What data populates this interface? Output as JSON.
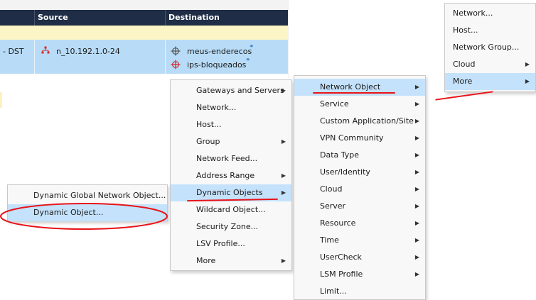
{
  "table": {
    "columns": [
      "Source",
      "Destination"
    ],
    "row": {
      "left_text": "- DST",
      "source": "n_10.192.1.0-24",
      "destinations": [
        "meus-enderecos",
        "ips-bloqueados"
      ]
    }
  },
  "menu_left": {
    "items": [
      "Dynamic Global Network Object...",
      "Dynamic Object..."
    ]
  },
  "menu_main": {
    "items": [
      {
        "label": "Gateways and Servers",
        "submenu": true
      },
      {
        "label": "Network...",
        "submenu": false
      },
      {
        "label": "Host...",
        "submenu": false
      },
      {
        "label": "Group",
        "submenu": true
      },
      {
        "label": "Network Feed...",
        "submenu": false
      },
      {
        "label": "Address Range",
        "submenu": true
      },
      {
        "label": "Dynamic Objects",
        "submenu": true
      },
      {
        "label": "Wildcard Object...",
        "submenu": false
      },
      {
        "label": "Security Zone...",
        "submenu": false
      },
      {
        "label": "LSV Profile...",
        "submenu": false
      },
      {
        "label": "More",
        "submenu": true
      }
    ]
  },
  "menu_categories": {
    "items": [
      {
        "label": "Network Object",
        "submenu": true
      },
      {
        "label": "Service",
        "submenu": true
      },
      {
        "label": "Custom Application/Site",
        "submenu": true
      },
      {
        "label": "VPN Community",
        "submenu": true
      },
      {
        "label": "Data Type",
        "submenu": true
      },
      {
        "label": "User/Identity",
        "submenu": true
      },
      {
        "label": "Cloud",
        "submenu": true
      },
      {
        "label": "Server",
        "submenu": true
      },
      {
        "label": "Resource",
        "submenu": true
      },
      {
        "label": "Time",
        "submenu": true
      },
      {
        "label": "UserCheck",
        "submenu": true
      },
      {
        "label": "LSM Profile",
        "submenu": true
      },
      {
        "label": "Limit...",
        "submenu": false
      }
    ]
  },
  "menu_network": {
    "items": [
      {
        "label": "Network...",
        "submenu": false
      },
      {
        "label": "Host...",
        "submenu": false
      },
      {
        "label": "Network Group...",
        "submenu": false
      },
      {
        "label": "Cloud",
        "submenu": true
      },
      {
        "label": "More",
        "submenu": true
      }
    ]
  },
  "colors": {
    "header_bg": "#1f2d46",
    "selected_row": "#b8dcf7",
    "highlight": "#c4e2fb",
    "annotation": "#e8141a"
  }
}
